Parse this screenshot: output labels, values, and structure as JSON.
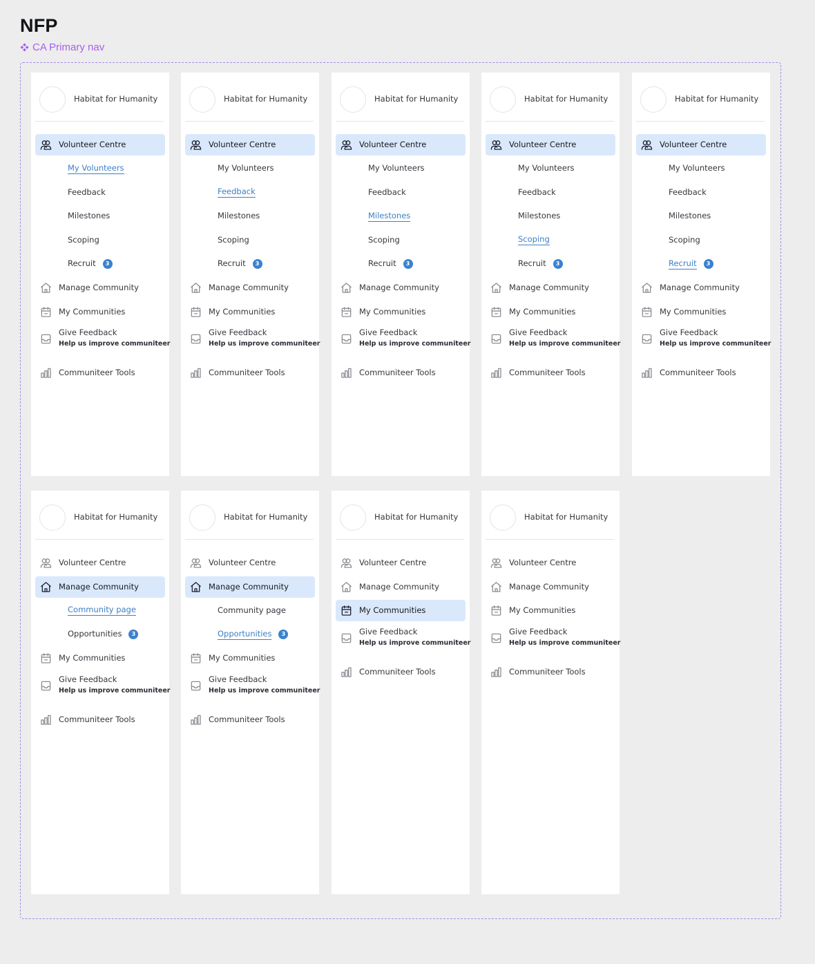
{
  "page": {
    "title": "NFP",
    "component_label": "CA Primary nav"
  },
  "org": {
    "name": "Habitat for Humanity"
  },
  "nav": {
    "volunteer_centre": "Volunteer Centre",
    "my_volunteers": "My Volunteers",
    "feedback": "Feedback",
    "milestones": "Milestones",
    "scoping": "Scoping",
    "recruit": "Recruit",
    "recruit_badge": "3",
    "manage_community": "Manage Community",
    "community_page": "Community page",
    "opportunities": "Opportunities",
    "opportunities_badge": "3",
    "my_communities": "My Communities",
    "give_feedback": "Give Feedback",
    "give_feedback_sub": "Help us improve communiteer",
    "communiteer_tools": "Communiteer Tools"
  },
  "variants": [
    {
      "active": "volunteer_centre",
      "expanded": "volunteer_centre",
      "selected_sub": "my_volunteers"
    },
    {
      "active": "volunteer_centre",
      "expanded": "volunteer_centre",
      "selected_sub": "feedback"
    },
    {
      "active": "volunteer_centre",
      "expanded": "volunteer_centre",
      "selected_sub": "milestones"
    },
    {
      "active": "volunteer_centre",
      "expanded": "volunteer_centre",
      "selected_sub": "scoping"
    },
    {
      "active": "volunteer_centre",
      "expanded": "volunteer_centre",
      "selected_sub": "recruit"
    },
    {
      "active": "manage_community",
      "expanded": "manage_community",
      "selected_sub": "community_page"
    },
    {
      "active": "manage_community",
      "expanded": "manage_community",
      "selected_sub": "opportunities"
    },
    {
      "active": "my_communities",
      "expanded": "",
      "selected_sub": ""
    },
    {
      "active": "",
      "expanded": "",
      "selected_sub": ""
    }
  ],
  "icons": {
    "volunteer_centre": "people-icon",
    "manage_community": "home-icon",
    "my_communities": "calendar-icon",
    "give_feedback": "inbox-icon",
    "communiteer_tools": "bar-chart-icon"
  },
  "colors": {
    "active_bg": "#dae8fc",
    "selected_link": "#3d7fc4",
    "badge": "#3a82cf",
    "frame_border": "#a98be8",
    "component_label": "#a95ef0"
  }
}
